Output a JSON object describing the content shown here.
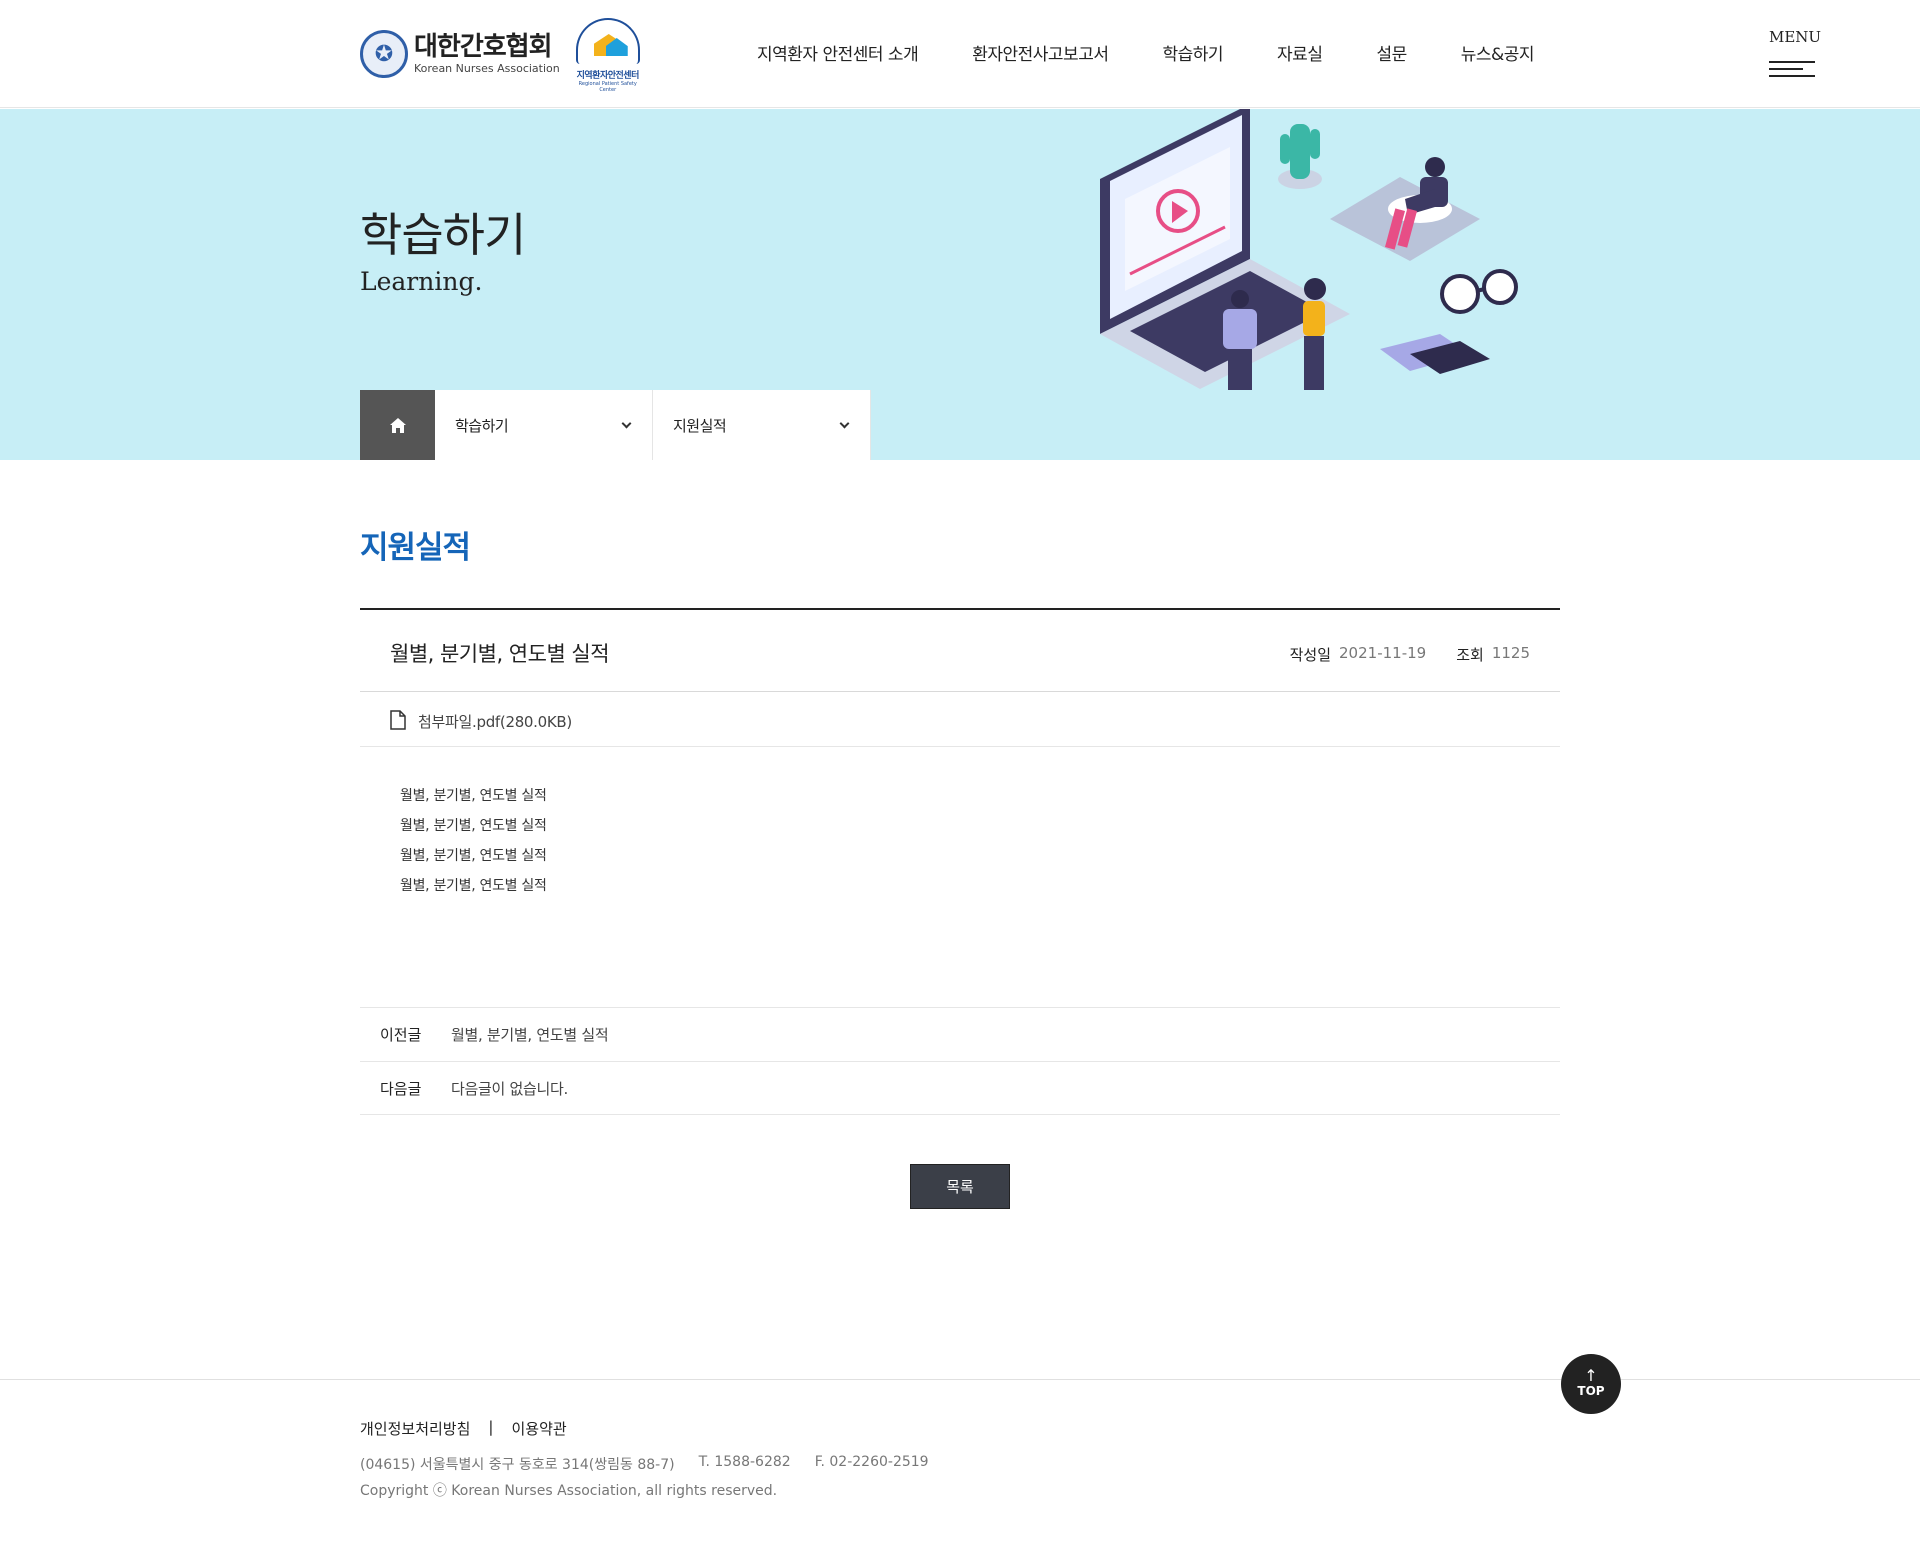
{
  "header": {
    "logo_ko": "대한간호협회",
    "logo_en": "Korean Nurses Association",
    "center_badge": "지역환자안전센터",
    "center_badge_en": "Regional Patient Safety Center",
    "nav": [
      {
        "label": "지역환자 안전센터 소개"
      },
      {
        "label": "환자안전사고보고서"
      },
      {
        "label": "학습하기"
      },
      {
        "label": "자료실"
      },
      {
        "label": "설문"
      },
      {
        "label": "뉴스&공지"
      }
    ],
    "menu_label": "MENU"
  },
  "visual": {
    "title": "학습하기",
    "subtitle": "Learning."
  },
  "location": {
    "home_icon": "home-icon",
    "depth1": "학습하기",
    "depth2": "지원실적"
  },
  "page_title": "지원실적",
  "post": {
    "subject": "월별, 분기별, 연도별 실적",
    "date_label": "작성일",
    "date": "2021-11-19",
    "views_label": "조회",
    "views": "1125",
    "attachment": "첨부파일.pdf(280.0KB)",
    "body_lines": [
      "월별, 분기별, 연도별 실적",
      "월별, 분기별, 연도별 실적",
      "월별, 분기별, 연도별 실적",
      "월별, 분기별, 연도별 실적"
    ]
  },
  "post_nav": {
    "prev_label": "이전글",
    "prev_title": "월별, 분기별, 연도별 실적",
    "next_label": "다음글",
    "next_title": "다음글이 없습니다."
  },
  "list_button": "목록",
  "footer": {
    "privacy": "개인정보처리방침",
    "separator": "|",
    "terms": "이용약관",
    "address": "(04615) 서울특별시 중구 동호로 314(쌍림동 88-7)",
    "tel": "T. 1588-6282",
    "fax": "F. 02-2260-2519",
    "copyright": "Copyright ⓒ Korean Nurses Association, all rights reserved."
  },
  "top_button": "TOP",
  "colors": {
    "accent": "#1565b8",
    "banner_bg": "#c7eef6",
    "button_bg": "#3b3f48",
    "home_bg": "#555555"
  }
}
